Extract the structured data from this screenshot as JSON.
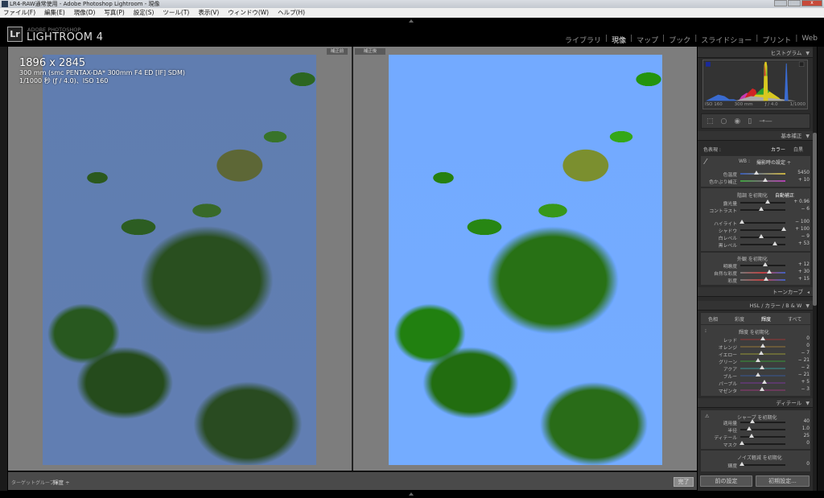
{
  "window": {
    "title": "LR4-RAW通常使用 - Adobe Photoshop Lightroom - 現像"
  },
  "menu": [
    "ファイル(F)",
    "編集(E)",
    "現像(D)",
    "写真(P)",
    "設定(S)",
    "ツール(T)",
    "表示(V)",
    "ウィンドウ(W)",
    "ヘルプ(H)"
  ],
  "logo": {
    "mark": "Lr",
    "sub": "ADOBE PHOTOSHOP",
    "main": "LIGHTROOM 4"
  },
  "modules": [
    {
      "label": "ライブラリ",
      "active": false
    },
    {
      "label": "現像",
      "active": true
    },
    {
      "label": "マップ",
      "active": false
    },
    {
      "label": "ブック",
      "active": false
    },
    {
      "label": "スライドショー",
      "active": false
    },
    {
      "label": "プリント",
      "active": false
    },
    {
      "label": "Web",
      "active": false
    }
  ],
  "view": {
    "before_label": "補正前",
    "after_label": "補正後",
    "info": {
      "dimensions": "1896 x 2845",
      "lens": "300 mm (smc PENTAX-DA* 300mm F4 ED [IF] SDM)",
      "exposure": "1/1000 秒 (ƒ / 4.0)、ISO 160"
    }
  },
  "toolbar": {
    "target_group_label": "ターゲットグループ :",
    "target_group_value": "輝度 ÷",
    "done": "完了"
  },
  "panel": {
    "histogram": {
      "title": "ヒストグラム",
      "iso": "ISO 160",
      "focal": "300 mm",
      "aperture": "ƒ / 4.0",
      "shutter": "1/1000"
    },
    "basic": {
      "title": "基本補正",
      "treatment_label": "色表現 :",
      "color": "カラー",
      "bw": "白黒",
      "wb_label": "WB :",
      "wb_value": "撮影時の設定 ÷",
      "tone_label": "階調 を初期化",
      "auto": "自動補正",
      "presence_label": "外観 を初期化",
      "wb_sliders": [
        {
          "label": "色温度",
          "value": "5450",
          "pos": 0.35
        },
        {
          "label": "色かぶり補正",
          "value": "+ 10",
          "pos": 0.56
        }
      ],
      "tone_sliders": [
        {
          "label": "露光量",
          "value": "+ 0.96",
          "pos": 0.6
        },
        {
          "label": "コントラスト",
          "value": "− 6",
          "pos": 0.47
        }
      ],
      "tone_sliders2": [
        {
          "label": "ハイライト",
          "value": "− 100",
          "pos": 0.03
        },
        {
          "label": "シャドウ",
          "value": "+ 100",
          "pos": 0.97
        },
        {
          "label": "白レベル",
          "value": "− 9",
          "pos": 0.47
        },
        {
          "label": "黒レベル",
          "value": "+ 53",
          "pos": 0.76
        }
      ],
      "presence_sliders": [
        {
          "label": "明瞭度",
          "value": "+ 12",
          "pos": 0.56
        },
        {
          "label": "自然な彩度",
          "value": "+ 30",
          "pos": 0.65
        },
        {
          "label": "彩度",
          "value": "+ 15",
          "pos": 0.57
        }
      ]
    },
    "tone_curve": {
      "title": "トーンカーブ"
    },
    "hsl": {
      "title": "HSL / カラー / B & W",
      "tabs": [
        "色相",
        "彩度",
        "輝度",
        "すべて"
      ],
      "active_tab": "輝度",
      "reset_label": "輝度 を初期化",
      "sliders": [
        {
          "label": "レッド",
          "value": "0",
          "pos": 0.5
        },
        {
          "label": "オレンジ",
          "value": "0",
          "pos": 0.5
        },
        {
          "label": "イエロー",
          "value": "− 7",
          "pos": 0.46
        },
        {
          "label": "グリーン",
          "value": "− 21",
          "pos": 0.4
        },
        {
          "label": "アクア",
          "value": "− 2",
          "pos": 0.49
        },
        {
          "label": "ブルー",
          "value": "− 21",
          "pos": 0.4
        },
        {
          "label": "パープル",
          "value": "+ 5",
          "pos": 0.53
        },
        {
          "label": "マゼンタ",
          "value": "− 3",
          "pos": 0.48
        }
      ]
    },
    "detail": {
      "title": "ディテール",
      "sharpen_label": "シャープ を初期化",
      "noise_label": "ノイズ軽減 を初期化",
      "sharpen": [
        {
          "label": "適用量",
          "value": "40",
          "pos": 0.27
        },
        {
          "label": "半径",
          "value": "1.0",
          "pos": 0.2
        },
        {
          "label": "ディテール",
          "value": "25",
          "pos": 0.25
        },
        {
          "label": "マスク",
          "value": "0",
          "pos": 0.03
        }
      ],
      "noise": [
        {
          "label": "輝度",
          "value": "0",
          "pos": 0.03
        }
      ]
    },
    "buttons": {
      "previous": "前の設定",
      "reset": "初期設定..."
    }
  },
  "colors": {
    "accent": "#eeeeee",
    "panel": "#2b2b2b",
    "sky": "#6e93d6"
  }
}
